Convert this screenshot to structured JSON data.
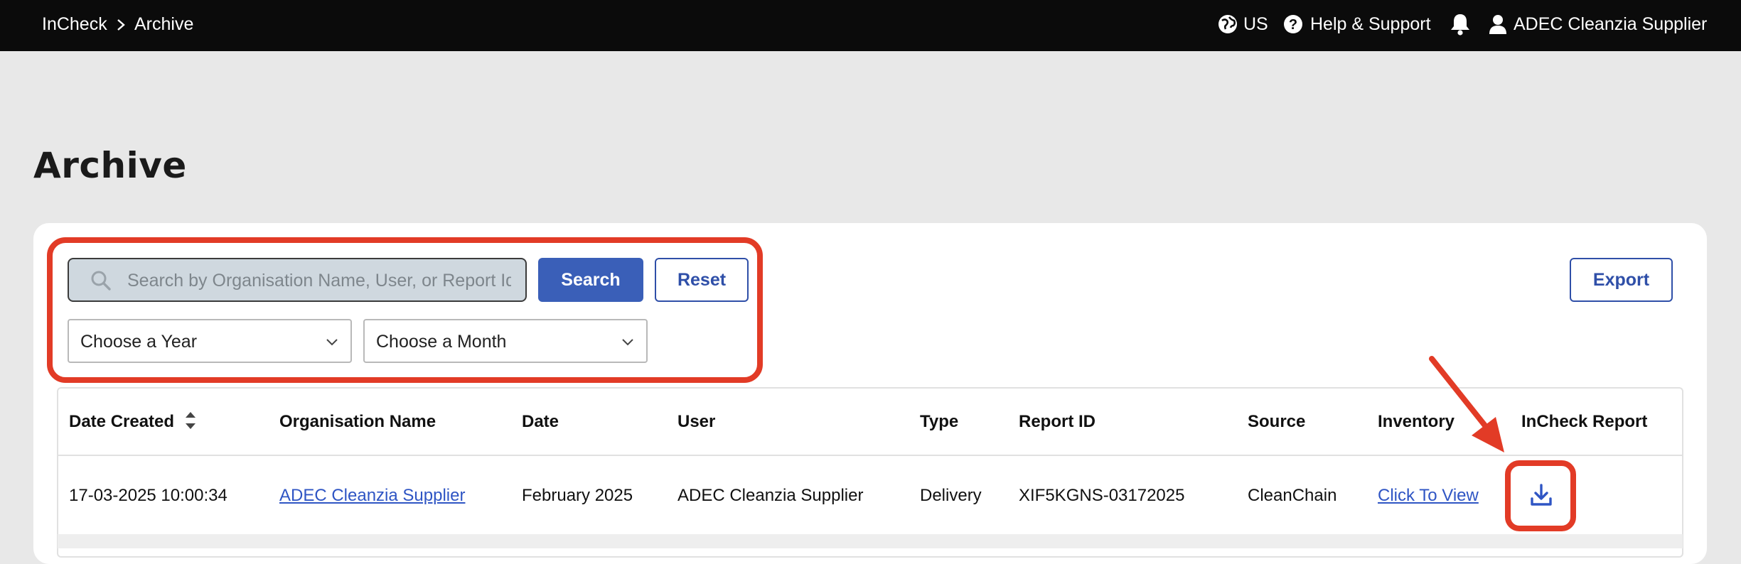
{
  "header": {
    "breadcrumb": [
      "InCheck",
      "Archive"
    ],
    "region": "US",
    "help": "Help & Support",
    "user": "ADEC Cleanzia Supplier"
  },
  "page": {
    "title": "Archive"
  },
  "filters": {
    "search_placeholder": "Search by Organisation Name, User, or Report Id",
    "search_button": "Search",
    "reset_button": "Reset",
    "export_button": "Export",
    "year_select": "Choose a Year",
    "month_select": "Choose a Month"
  },
  "table": {
    "columns": [
      "Date Created",
      "Organisation Name",
      "Date",
      "User",
      "Type",
      "Report ID",
      "Source",
      "Inventory",
      "InCheck Report"
    ],
    "rows": [
      {
        "date_created": "17-03-2025 10:00:34",
        "organisation": "ADEC Cleanzia Supplier",
        "date": "February 2025",
        "user": "ADEC Cleanzia Supplier",
        "type": "Delivery",
        "report_id": "XIF5KGNS-03172025",
        "source": "CleanChain",
        "inventory": "Click To View",
        "report_icon": "download-icon"
      }
    ]
  },
  "colors": {
    "topbar": "#0b0b0b",
    "primary": "#3a5fb8",
    "annotation": "#e23b26",
    "link": "#2f55c4"
  }
}
